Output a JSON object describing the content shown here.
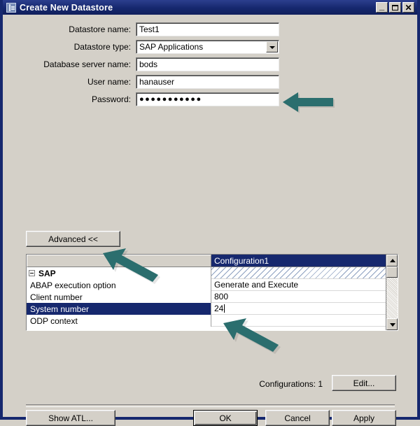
{
  "window": {
    "title": "Create New Datastore",
    "icon": "datastore-window-icon",
    "minimize_label": "_",
    "maximize_label": "",
    "close_label": "✕"
  },
  "form": {
    "fields": [
      {
        "label": "Datastore name:",
        "value": "Test1",
        "type": "text",
        "name": "datastore-name"
      },
      {
        "label": "Datastore type:",
        "value": "SAP Applications",
        "type": "combo",
        "name": "datastore-type"
      },
      {
        "label": "Database server name:",
        "value": "bods",
        "type": "text",
        "name": "database-server-name"
      },
      {
        "label": "User name:",
        "value": "hanauser",
        "type": "text",
        "name": "user-name"
      },
      {
        "label": "Password:",
        "value": "●●●●●●●●●●●",
        "type": "password",
        "name": "password"
      }
    ]
  },
  "advanced": {
    "label": "Advanced <<"
  },
  "grid": {
    "header_left": "",
    "header_right": "Configuration1",
    "rows": [
      {
        "name": "SAP",
        "value": "",
        "group": true,
        "selected": false,
        "hatch": true
      },
      {
        "name": "ABAP execution option",
        "value": "Generate and Execute",
        "group": false,
        "selected": false,
        "hatch": false
      },
      {
        "name": "Client number",
        "value": "800",
        "group": false,
        "selected": false,
        "hatch": false
      },
      {
        "name": "System number",
        "value": "24",
        "group": false,
        "selected": true,
        "hatch": false,
        "caret": true
      },
      {
        "name": "ODP context",
        "value": "",
        "group": false,
        "selected": false,
        "hatch": false
      }
    ]
  },
  "footer": {
    "configurations_label": "Configurations: 1",
    "edit_label": "Edit...",
    "show_atl_label": "Show ATL...",
    "ok_label": "OK",
    "cancel_label": "Cancel",
    "apply_label": "Apply"
  },
  "annotations": {
    "arrow_color": "#2b6e6e",
    "items": [
      {
        "name": "arrow-pointing-to-user-name",
        "target": "User name field"
      },
      {
        "name": "arrow-pointing-to-advanced-button",
        "target": "Advanced << button"
      },
      {
        "name": "arrow-pointing-to-system-number",
        "target": "System number value"
      }
    ]
  },
  "colors": {
    "titlebar": "#16286e",
    "dialog_face": "#d4d0c8",
    "selection": "#16286e",
    "field_background": "#ffffff",
    "annotation_teal": "#2b6e6e"
  }
}
